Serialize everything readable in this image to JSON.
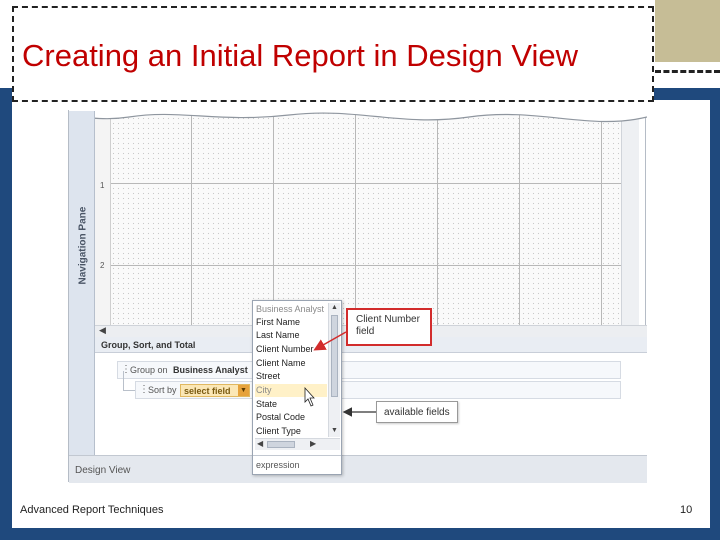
{
  "slide": {
    "title": "Creating an Initial Report in Design View",
    "footer_left": "Advanced Report Techniques",
    "page_number": "10"
  },
  "screenshot": {
    "nav_pane_label": "Navigation Pane",
    "ruler_numbers": [
      "1",
      "2"
    ],
    "group_sort_total_title": "Group, Sort, and Total",
    "group_row": {
      "label": "Group on",
      "field": "Business Analyst"
    },
    "sort_row": {
      "label": "Sort by",
      "combo_value": "select field"
    },
    "status_bar": "Design View",
    "dropdown": {
      "items": [
        "Business Analyst",
        "First Name",
        "Last Name",
        "Client Number",
        "Client Name",
        "Street",
        "City",
        "State",
        "Postal Code",
        "Client Type"
      ],
      "highlighted_item": "City",
      "footer": "expression"
    },
    "callouts": {
      "client_number": "Client Number field",
      "available_fields": "available fields"
    },
    "colors": {
      "title": "#c00000",
      "frame": "#1f497d",
      "accent_bar": "#c6bd96",
      "callout_border": "#d22c2c"
    }
  }
}
